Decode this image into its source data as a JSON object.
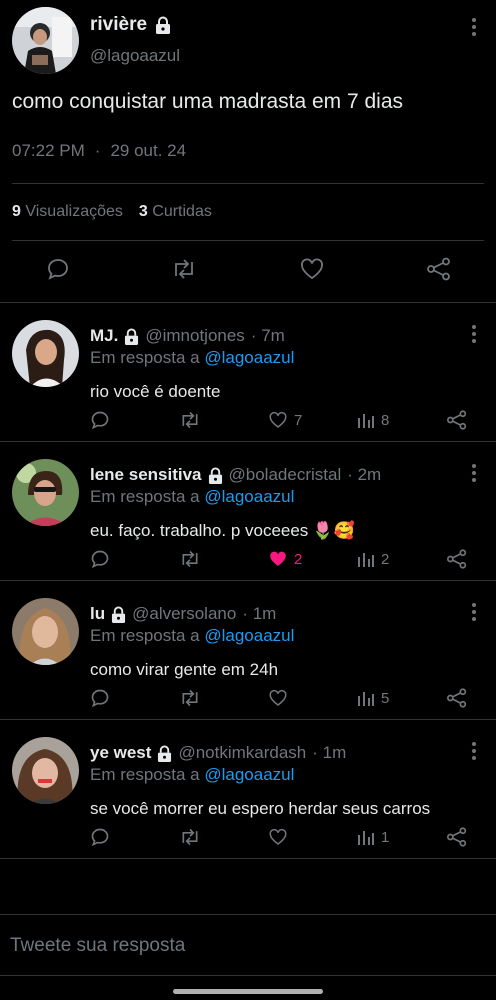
{
  "colors": {
    "background": "#000000",
    "text": "#e7e9ea",
    "muted": "#71767b",
    "link": "#1d9bf0",
    "like": "#f91880",
    "divider": "#2f3336"
  },
  "tweet": {
    "name": "rivière",
    "handle": "@lagoaazul",
    "text": "como conquistar uma madrasta em 7 dias",
    "time": "07:22 PM",
    "dot": "·",
    "date": "29 out. 24",
    "views_count": "9",
    "views_label": "Visualizações",
    "likes_count": "3",
    "likes_label": "Curtidas",
    "icons": [
      "lock-icon",
      "more-icon",
      "reply-icon",
      "retweet-icon",
      "like-icon",
      "share-icon"
    ]
  },
  "replies": [
    {
      "name": "MJ.",
      "handle": "@imnotjones",
      "time": "· 7m",
      "in_reply_prefix": "Em resposta a",
      "in_reply_handle": "@lagoaazul",
      "text": "rio você é doente",
      "emoji": "",
      "likes": "7",
      "views": "8",
      "liked": false
    },
    {
      "name": "lene sensitiva",
      "handle": "@boladecristal",
      "time": "· 2m",
      "in_reply_prefix": "Em resposta a",
      "in_reply_handle": "@lagoaazul",
      "text": "eu. faço. trabalho. p voceees",
      "emoji": "🌷🥰",
      "likes": "2",
      "views": "2",
      "liked": true
    },
    {
      "name": "lu",
      "handle": "@alversolano",
      "time": "· 1m",
      "in_reply_prefix": "Em resposta a",
      "in_reply_handle": "@lagoaazul",
      "text": "como virar gente em 24h",
      "emoji": "",
      "likes": "",
      "views": "5",
      "liked": false
    },
    {
      "name": "ye west",
      "handle": "@notkimkardash",
      "time": "· 1m",
      "in_reply_prefix": "Em resposta a",
      "in_reply_handle": "@lagoaazul",
      "text": "se você morrer eu espero herdar seus carros",
      "emoji": "",
      "likes": "",
      "views": "1",
      "liked": false
    }
  ],
  "compose": {
    "placeholder": "Tweete sua resposta"
  }
}
